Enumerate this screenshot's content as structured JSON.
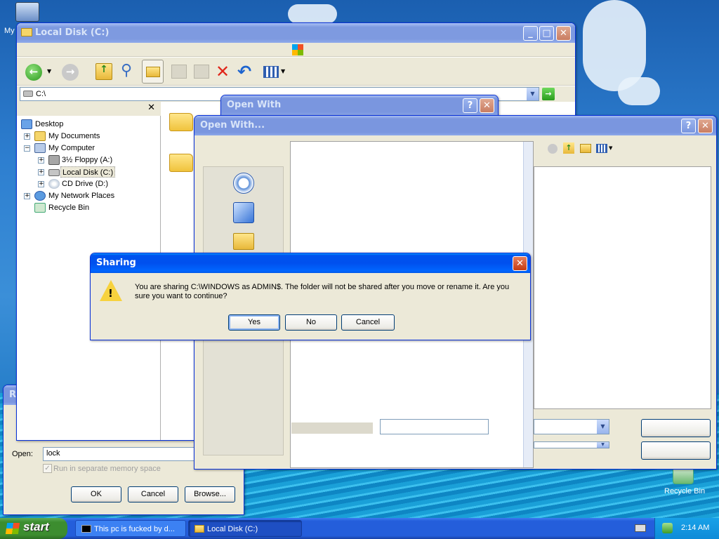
{
  "desktop": {
    "my_computer_label": "My",
    "recycle_bin_label": "Recycle Bin"
  },
  "explorer": {
    "title": "Local Disk (C:)",
    "address": "C:\\",
    "tree": [
      {
        "label": "Desktop"
      },
      {
        "label": "My Documents"
      },
      {
        "label": "My Computer"
      },
      {
        "label": "3½ Floppy (A:)"
      },
      {
        "label": "Local Disk (C:)"
      },
      {
        "label": "CD Drive (D:)"
      },
      {
        "label": "My Network Places"
      },
      {
        "label": "Recycle Bin"
      }
    ]
  },
  "open_with_back": {
    "title": "Open With"
  },
  "open_with_front": {
    "title": "Open With..."
  },
  "run": {
    "title": "R",
    "open_label": "Open:",
    "open_value": "lock",
    "checkbox_label": "Run in separate memory space",
    "ok": "OK",
    "cancel": "Cancel",
    "browse": "Browse..."
  },
  "sharing": {
    "title": "Sharing",
    "message": "You are sharing C:\\WINDOWS as ADMIN$. The folder will not be shared after you move or rename it. Are you sure you want to continue?",
    "yes": "Yes",
    "no": "No",
    "cancel": "Cancel"
  },
  "taskbar": {
    "start": "start",
    "tasks": [
      "This pc is fucked by d...",
      "Local Disk (C:)"
    ],
    "clock": "2:14 AM"
  },
  "colors": {
    "title_active": "#0053ee",
    "title_inactive": "#7a96df",
    "taskbar": "#245edb",
    "start_button": "#3c8d2f",
    "window_face": "#ece9d8"
  }
}
